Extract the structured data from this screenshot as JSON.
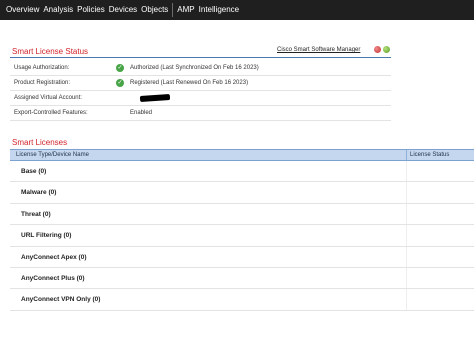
{
  "nav": {
    "items": [
      "Overview",
      "Analysis",
      "Policies",
      "Devices",
      "Objects"
    ],
    "items_after_sep": [
      "AMP",
      "Intelligence"
    ]
  },
  "status": {
    "title": "Smart License Status",
    "link": "Cisco Smart Software Manager",
    "rows": [
      {
        "label": "Usage Authorization:",
        "value": "Authorized (Last Synchronized On Feb 16 2023)"
      },
      {
        "label": "Product Registration:",
        "value": "Registered (Last Renewed On Feb 16 2023)"
      },
      {
        "label": "Assigned Virtual Account:",
        "value": ""
      },
      {
        "label": "Export-Controlled Features:",
        "value": "Enabled"
      }
    ]
  },
  "licenses": {
    "title": "Smart Licenses",
    "col_name": "License Type/Device Name",
    "col_status": "License Status",
    "rows": [
      {
        "name": "Base (0)"
      },
      {
        "name": "Malware (0)"
      },
      {
        "name": "Threat (0)"
      },
      {
        "name": "URL Filtering (0)"
      },
      {
        "name": "AnyConnect Apex (0)"
      },
      {
        "name": "AnyConnect Plus (0)"
      },
      {
        "name": "AnyConnect VPN Only (0)"
      }
    ]
  },
  "icons": {
    "refresh": "refresh-icon",
    "check": "check-circle-icon"
  },
  "colors": {
    "accent_red": "#d2232a",
    "header_blue": "#c5d7ee",
    "nav_bg": "#1f1f1f",
    "status_green": "#47a447"
  }
}
